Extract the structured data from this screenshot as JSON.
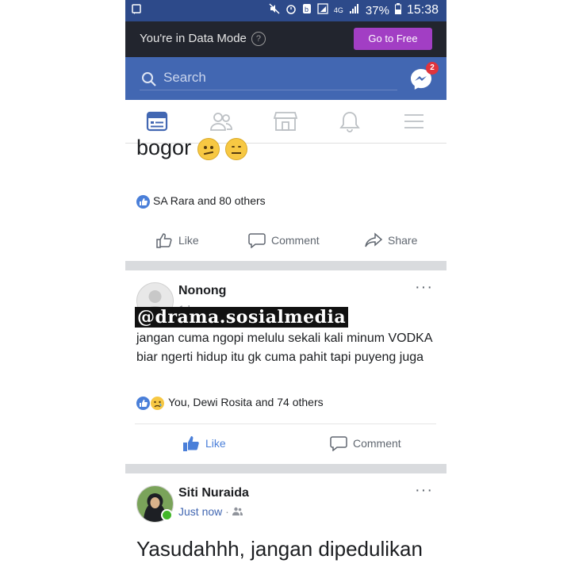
{
  "status_bar": {
    "battery": "37%",
    "time": "15:38",
    "network": "4G"
  },
  "data_mode": {
    "message": "You're in Data Mode",
    "help_symbol": "?",
    "button_label": "Go to Free"
  },
  "search": {
    "placeholder": "Search",
    "messenger_badge": "2"
  },
  "nav_tabs": [
    "news-feed",
    "friends",
    "marketplace",
    "notifications",
    "menu"
  ],
  "post1": {
    "text_fragment": "bogor",
    "reactions_text": "SA Rara and 80 others",
    "actions": {
      "like": "Like",
      "comment": "Comment",
      "share": "Share"
    }
  },
  "post2": {
    "author": "Nonong",
    "time": "1 hr",
    "watermark": "@drama.sosialmedia",
    "text": "jangan cuma ngopi melulu sekali kali minum VODKA biar ngerti hidup itu gk cuma pahit tapi puyeng juga",
    "reactions_text": "You, Dewi Rosita and 74 others",
    "actions": {
      "like": "Like",
      "comment": "Comment"
    }
  },
  "post3": {
    "author": "Siti Nuraida",
    "time": "Just now",
    "text": "Yasudahhh, jangan dipedulikan"
  },
  "colors": {
    "brand_blue": "#4267b2",
    "status_bar": "#2d4a8a",
    "data_bar": "#22252e",
    "go_free_purple": "#a23ec4",
    "liked_blue": "#4a7fd9"
  }
}
